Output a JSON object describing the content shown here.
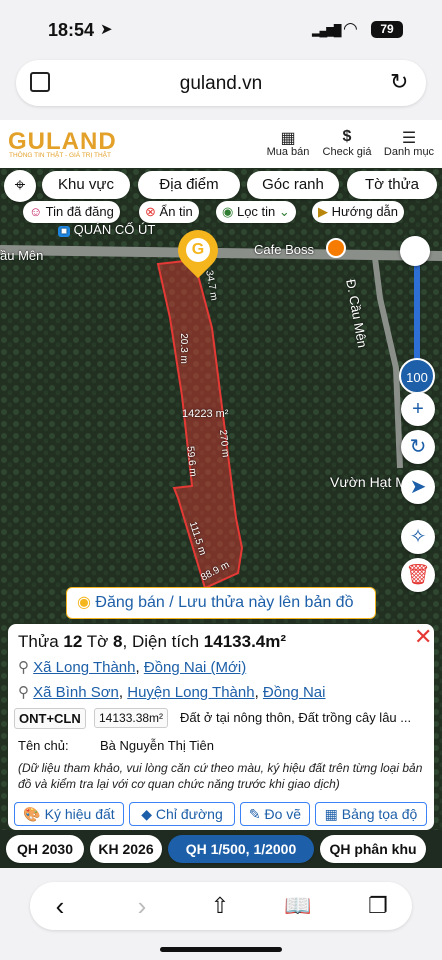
{
  "status": {
    "time": "18:54",
    "battery": "79"
  },
  "browser": {
    "url": "guland.vn"
  },
  "app": {
    "logo": "GULAND",
    "tagline": "THÔNG TIN THẬT - GIÁ TRỊ THẬT",
    "menu": [
      {
        "label": "Mua bán",
        "icon": "building-icon"
      },
      {
        "label": "Check giá",
        "icon": "dollar-icon"
      },
      {
        "label": "Danh mục",
        "icon": "hamburger-icon"
      }
    ]
  },
  "filters": {
    "row1": [
      "Khu vực",
      "Địa điểm",
      "Góc ranh",
      "Tờ thửa"
    ],
    "row2": [
      "Tin đã đăng",
      "Ẩn tin",
      "Lọc tin",
      "Hướng dẫn"
    ]
  },
  "map": {
    "labels": {
      "shop": "QUÁN CỐ ÚT",
      "cafe": "Cafe Boss",
      "road_left": "ầu Mên",
      "road_right": "Đ. Cầu Mên",
      "poi": "Vườn Hạt M"
    },
    "parcel": {
      "area": "14223 m²",
      "dims": [
        "34.7 m",
        "20.3 m",
        "270 m",
        "59.6 m",
        "111.5 m",
        "88.9 m"
      ]
    },
    "zoom": "100",
    "post_banner": "Đăng bán / Lưu thửa này lên bản đồ"
  },
  "card": {
    "title_prefix": "Thửa",
    "parcel_no": "12",
    "sheet_prefix": "Tờ",
    "sheet_no": "8",
    "area_prefix": ", Diện tích",
    "area": "14133.4m²",
    "addr_new": {
      "commune": "Xã Long Thành",
      "sep": ",",
      "province": "Đồng Nai (Mới)"
    },
    "addr_old": {
      "commune": "Xã Bình Sơn",
      "district": "Huyện Long Thành",
      "province": "Đồng Nai"
    },
    "land_code": "ONT+CLN",
    "land_area": "14133.38m²",
    "land_desc": "Đất ở tại nông thôn, Đất trồng cây lâu ...",
    "owner_label": "Tên chủ:",
    "owner": "Bà Nguyễn Thị Tiên",
    "disclaimer": "(Dữ liệu tham khảo, vui lòng căn cứ theo màu, ký hiệu đất trên từng loại bản đồ và kiểm tra lại với cơ quan chức năng trước khi giao dịch)",
    "actions": [
      "Ký hiệu đất",
      "Chỉ đường",
      "Đo vẽ",
      "Bảng tọa độ"
    ]
  },
  "plan_tabs": [
    "QH 2030",
    "KH 2026",
    "QH 1/500, 1/2000",
    "QH phân khu"
  ],
  "colors": {
    "accent": "#1d5fa8",
    "brand": "#e3a12a",
    "parcel": "#e53935",
    "active_tab": "#1d5fa8"
  }
}
